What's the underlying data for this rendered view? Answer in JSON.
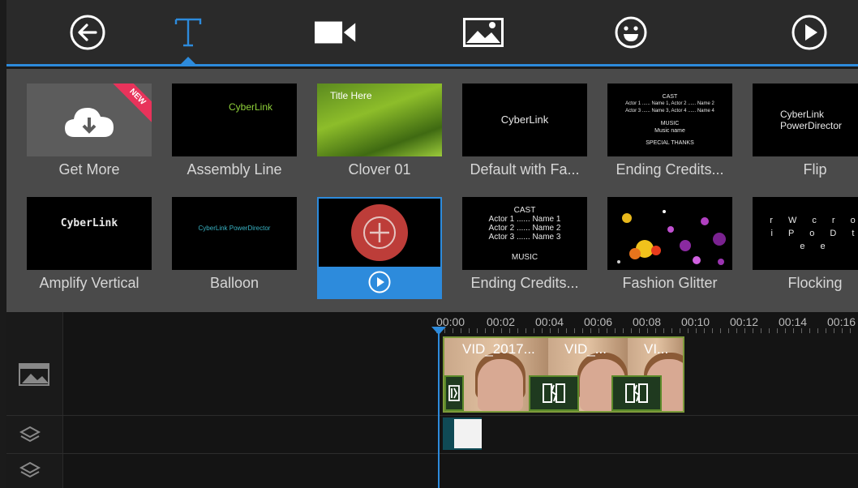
{
  "toolbar": {
    "tabs": [
      {
        "name": "back",
        "icon": "back-arrow-icon"
      },
      {
        "name": "title",
        "icon": "title-T-icon",
        "active": true
      },
      {
        "name": "video",
        "icon": "video-camera-icon"
      },
      {
        "name": "photo",
        "icon": "image-icon"
      },
      {
        "name": "sticker",
        "icon": "smiley-icon"
      },
      {
        "name": "play",
        "icon": "play-icon"
      }
    ],
    "accent_color": "#2d8bdc"
  },
  "templates": {
    "items": [
      {
        "label": "Get More",
        "badge": "NEW"
      },
      {
        "label": "Assembly Line",
        "thumb_text": "CyberLink"
      },
      {
        "label": "Clover 01",
        "thumb_text": "Title Here"
      },
      {
        "label": "Default with Fa...",
        "thumb_text": "CyberLink"
      },
      {
        "label": "Ending Credits...",
        "thumb_lines": [
          "CAST",
          "Actor 1 ...... Name 1, Actor 2 ...... Name 2",
          "Actor 3 ...... Name 3, Actor 4 ...... Name 4",
          "MUSIC",
          "Music name",
          "SPECIAL THANKS"
        ]
      },
      {
        "label": "Flip",
        "thumb_lines": [
          "CyberLink",
          "PowerDirector"
        ]
      },
      {
        "label": "Amplify Vertical",
        "thumb_text": "CyberLink"
      },
      {
        "label": "Balloon",
        "thumb_text": "CyberLink PowerDirector"
      },
      {
        "label": "",
        "selected": true
      },
      {
        "label": "Ending Credits...",
        "thumb_lines": [
          "CAST",
          "Actor 1 ...... Name 1",
          "Actor 2 ...... Name 2",
          "Actor 3 ...... Name 3",
          "MUSIC"
        ]
      },
      {
        "label": "Fashion Glitter"
      },
      {
        "label": "Flocking",
        "thumb_letters": "r W c r o i P o D t e e"
      }
    ]
  },
  "timeline": {
    "ruler_labels": [
      "00:00",
      "00:02",
      "00:04",
      "00:06",
      "00:08",
      "00:10",
      "00:12",
      "00:14",
      "00:16"
    ],
    "clips": [
      {
        "name": "VID_2017..."
      },
      {
        "name": "VID_..."
      },
      {
        "name": "VI..."
      }
    ],
    "track_icons": [
      "video-track-icon",
      "layers-icon",
      "layers-icon"
    ]
  }
}
